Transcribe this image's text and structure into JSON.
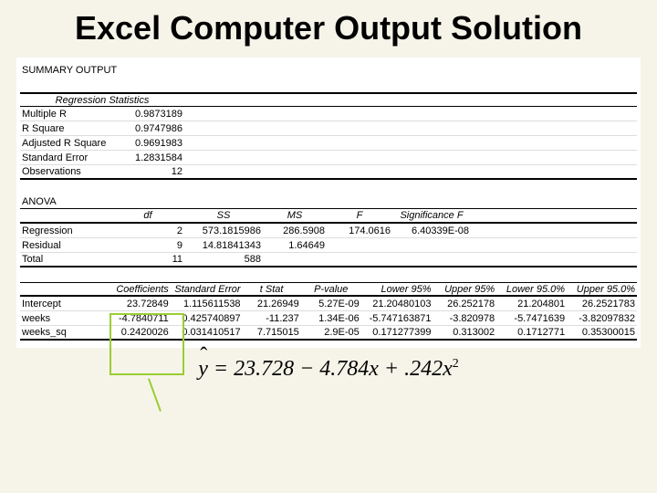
{
  "title": "Excel Computer Output Solution",
  "summary_label": "SUMMARY OUTPUT",
  "regstats_header": "Regression Statistics",
  "regstats": [
    {
      "label": "Multiple R",
      "value": "0.9873189"
    },
    {
      "label": "R Square",
      "value": "0.9747986"
    },
    {
      "label": "Adjusted R Square",
      "value": "0.9691983"
    },
    {
      "label": "Standard Error",
      "value": "1.2831584"
    },
    {
      "label": "Observations",
      "value": "12"
    }
  ],
  "anova_label": "ANOVA",
  "anova_headers": {
    "df": "df",
    "ss": "SS",
    "ms": "MS",
    "f": "F",
    "sigf": "Significance F"
  },
  "anova": [
    {
      "label": "Regression",
      "df": "2",
      "ss": "573.1815986",
      "ms": "286.5908",
      "f": "174.0616",
      "sigf": "6.40339E-08"
    },
    {
      "label": "Residual",
      "df": "9",
      "ss": "14.81841343",
      "ms": "1.64649",
      "f": "",
      "sigf": ""
    },
    {
      "label": "Total",
      "df": "11",
      "ss": "588",
      "ms": "",
      "f": "",
      "sigf": ""
    }
  ],
  "coef_headers": {
    "coef": "Coefficients",
    "se": "Standard Error",
    "t": "t Stat",
    "p": "P-value",
    "l95": "Lower 95%",
    "u95": "Upper 95%",
    "l95b": "Lower 95.0%",
    "u95b": "Upper 95.0%"
  },
  "coef": [
    {
      "label": "Intercept",
      "coef": "23.72849",
      "se": "1.115611538",
      "t": "21.26949",
      "p": "5.27E-09",
      "l95": "21.20480103",
      "u95": "26.252178",
      "l95b": "21.204801",
      "u95b": "26.2521783"
    },
    {
      "label": "weeks",
      "coef": "-4.7840711",
      "se": "0.425740897",
      "t": "-11.237",
      "p": "1.34E-06",
      "l95": "-5.747163871",
      "u95": "-3.820978",
      "l95b": "-5.7471639",
      "u95b": "-3.82097832"
    },
    {
      "label": "weeks_sq",
      "coef": "0.2420026",
      "se": "0.031410517",
      "t": "7.715015",
      "p": "2.9E-05",
      "l95": "0.171277399",
      "u95": "0.313002",
      "l95b": "0.1712771",
      "u95b": "0.35300015"
    }
  ],
  "equation": {
    "lhs": "y",
    "rhs": " = 23.728 − 4.784x + .242x",
    "exp": "2"
  }
}
